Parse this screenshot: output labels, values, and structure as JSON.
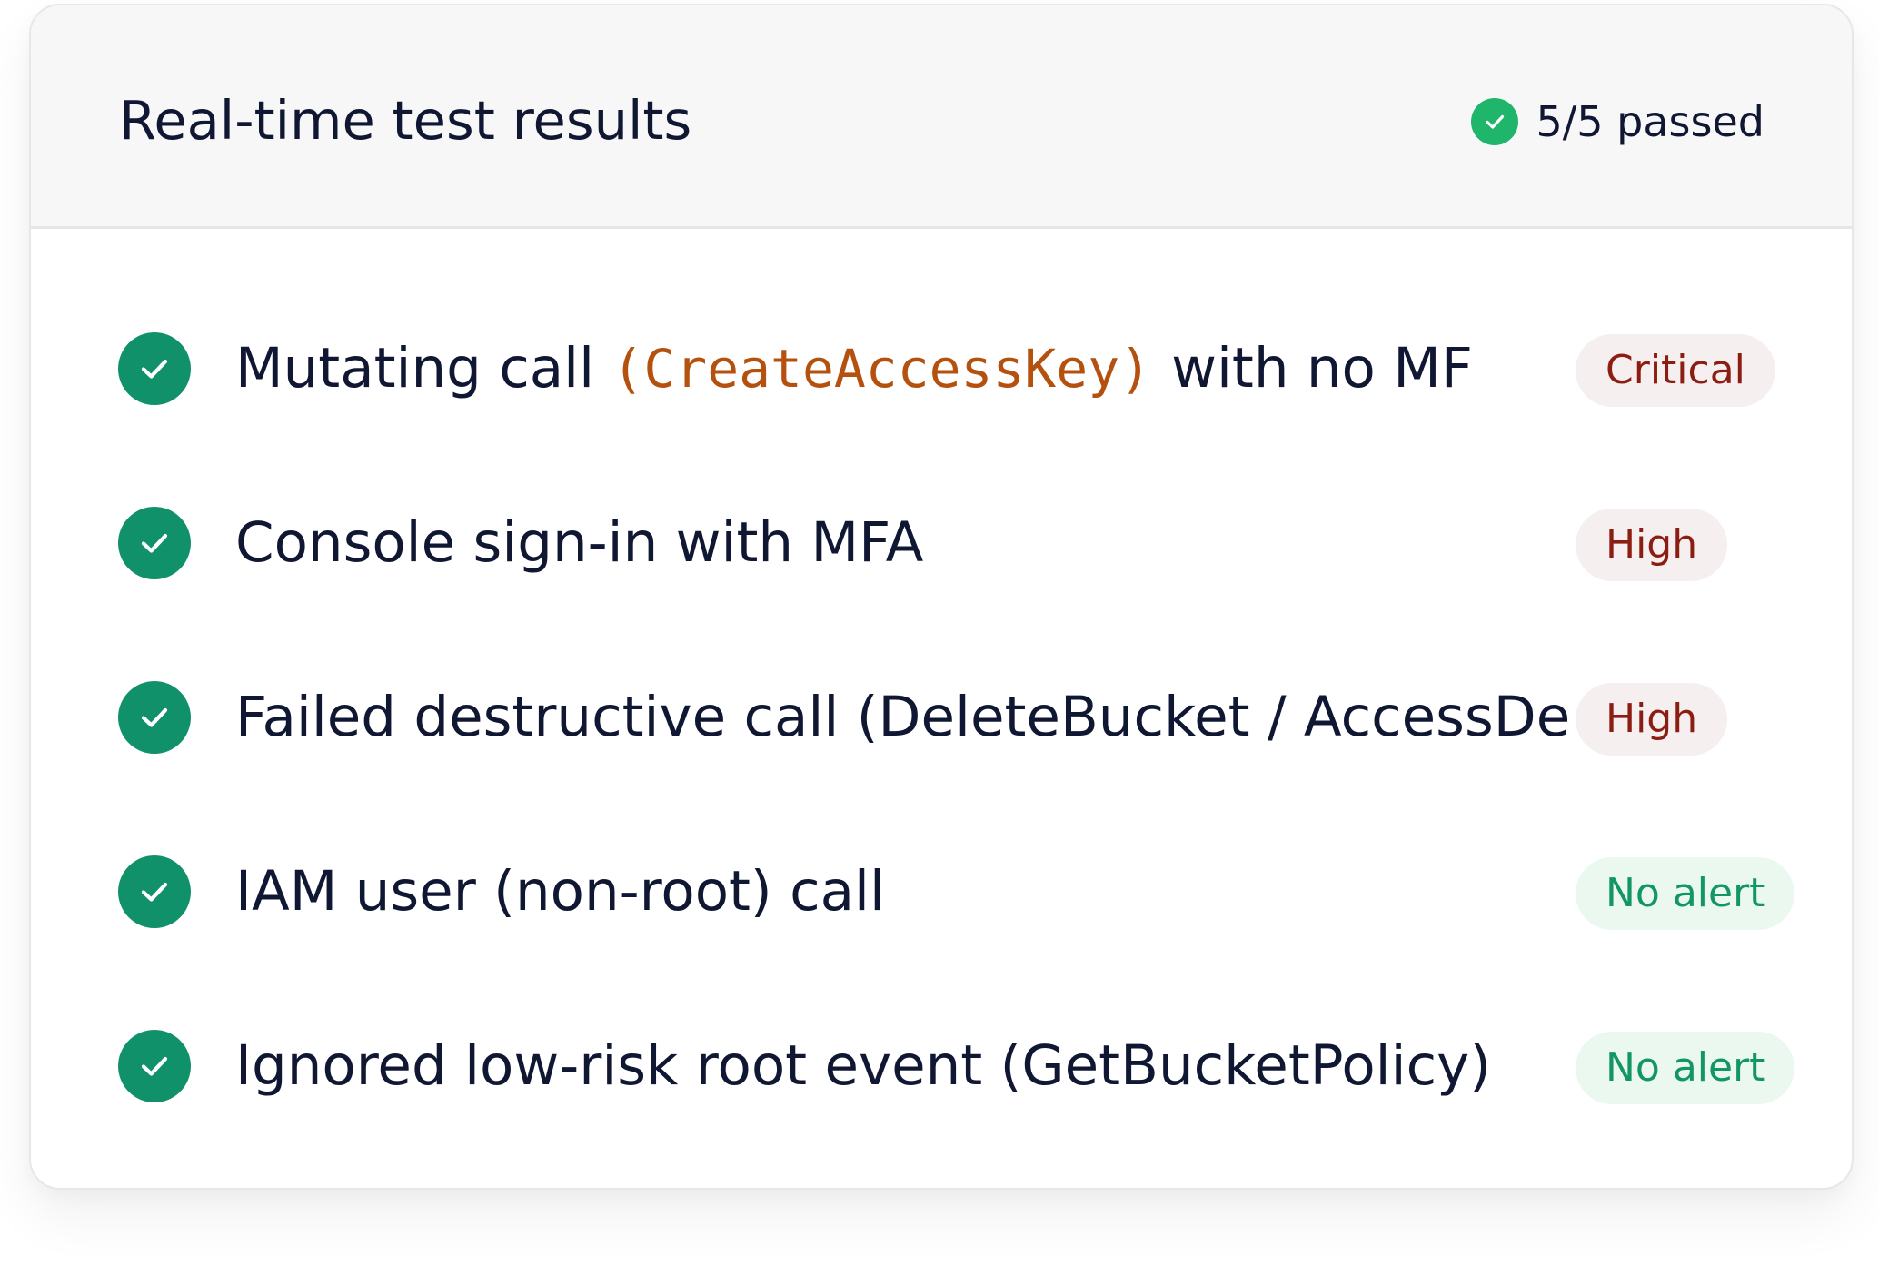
{
  "panel": {
    "title": "Real-time test results",
    "summary": "5/5 passed",
    "summary_icon": "check-circle-icon",
    "colors": {
      "pass": "#11916a",
      "summary_pass": "#1fb56b",
      "severity_text": "#8c1d12",
      "no_alert_text": "#129663",
      "code_text": "#b5510f"
    }
  },
  "tests": [
    {
      "status": "passed",
      "icon": "check-circle-icon",
      "label_prefix": "Mutating call ",
      "label_code": "(CreateAccessKey)",
      "label_suffix": "with no MF",
      "badge": "Critical",
      "badge_kind": "critical"
    },
    {
      "status": "passed",
      "icon": "check-circle-icon",
      "label_prefix": "Console sign-in with MFA",
      "badge": "High",
      "badge_kind": "high"
    },
    {
      "status": "passed",
      "icon": "check-circle-icon",
      "label_prefix": "Failed destructive call (DeleteBucket / AccessDe",
      "badge": "High",
      "badge_kind": "high"
    },
    {
      "status": "passed",
      "icon": "check-circle-icon",
      "label_prefix": "IAM user (non-root) call",
      "badge": "No alert",
      "badge_kind": "none"
    },
    {
      "status": "passed",
      "icon": "check-circle-icon",
      "label_prefix": "Ignored low-risk root event (GetBucketPolicy)",
      "badge": "No alert",
      "badge_kind": "none"
    }
  ]
}
